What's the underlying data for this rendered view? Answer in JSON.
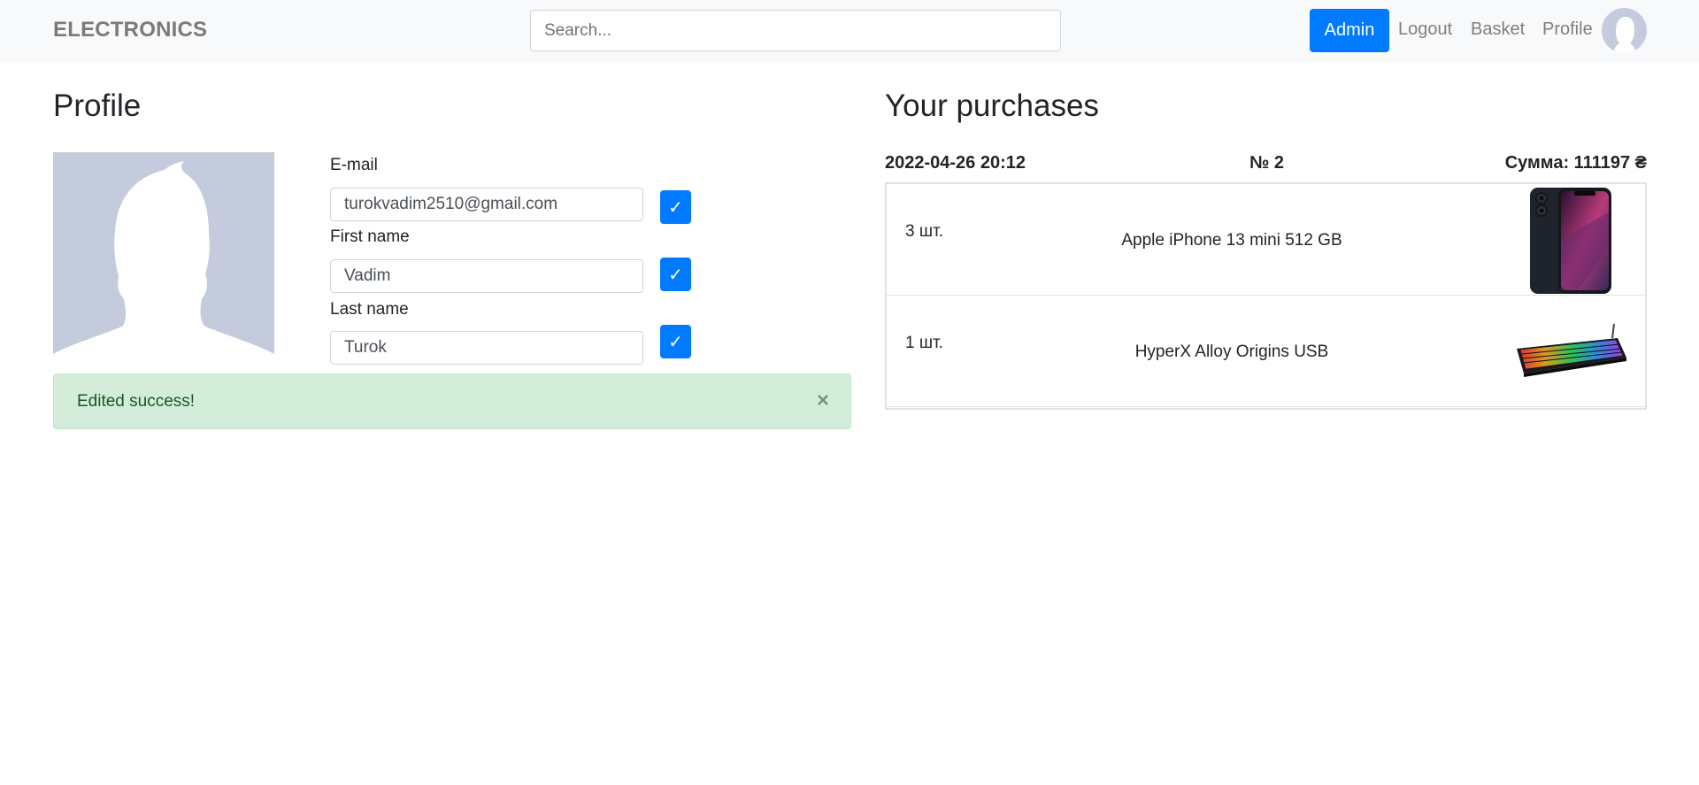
{
  "navbar": {
    "brand": "ELECTRONICS",
    "search_placeholder": "Search...",
    "admin_label": "Admin",
    "logout_label": "Logout",
    "basket_label": "Basket",
    "profile_label": "Profile"
  },
  "profile": {
    "title": "Profile",
    "email_label": "E-mail",
    "email_value": "turokvadim2510@gmail.com",
    "first_name_label": "First name",
    "first_name_value": "Vadim",
    "last_name_label": "Last name",
    "last_name_value": "Turok",
    "confirm_symbol": "✓",
    "alert_text": "Edited success!",
    "alert_close": "×"
  },
  "purchases": {
    "title": "Your purchases",
    "orders": [
      {
        "date": "2022-04-26 20:12",
        "number": "№ 2",
        "sum": "Сумма: 111197 ₴",
        "items": [
          {
            "qty": "3 шт.",
            "name": "Apple iPhone 13 mini 512 GB",
            "image_icon": "smartphone-image"
          },
          {
            "qty": "1 шт.",
            "name": "HyperX Alloy Origins USB",
            "image_icon": "keyboard-image"
          }
        ]
      }
    ]
  },
  "colors": {
    "primary": "#007bff",
    "navbar_bg": "#f8f9fa",
    "avatar_bg": "#c3cbdd",
    "alert_bg": "#d4edda",
    "alert_text": "#155724"
  }
}
